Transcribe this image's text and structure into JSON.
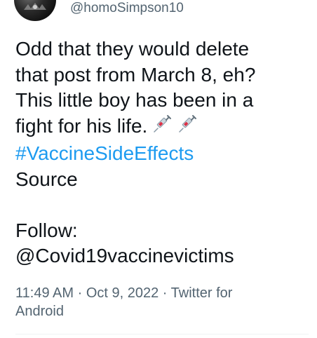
{
  "author": {
    "handle": "@homoSimpson10",
    "avatar_icon": "profile-avatar-icon"
  },
  "tweet": {
    "lines": [
      "Odd that they would delete",
      "that post from March 8, eh?",
      "This little boy has been in a",
      "fight for his life."
    ],
    "emoji_icon": "syringe-icon",
    "hashtag": "#VaccineSideEffects",
    "source_label": "Source",
    "follow_label": "Follow:",
    "mention": "@Covid19vaccinevictims"
  },
  "meta": {
    "time": "11:49 AM",
    "separator1": " · ",
    "date": "Oct 9, 2022",
    "separator2": " · ",
    "client_line1": "Twitter for",
    "client_line2": "Android"
  },
  "colors": {
    "text": "#0f1419",
    "secondary": "#536471",
    "link": "#1d9bf0",
    "divider": "#eff3f4"
  }
}
